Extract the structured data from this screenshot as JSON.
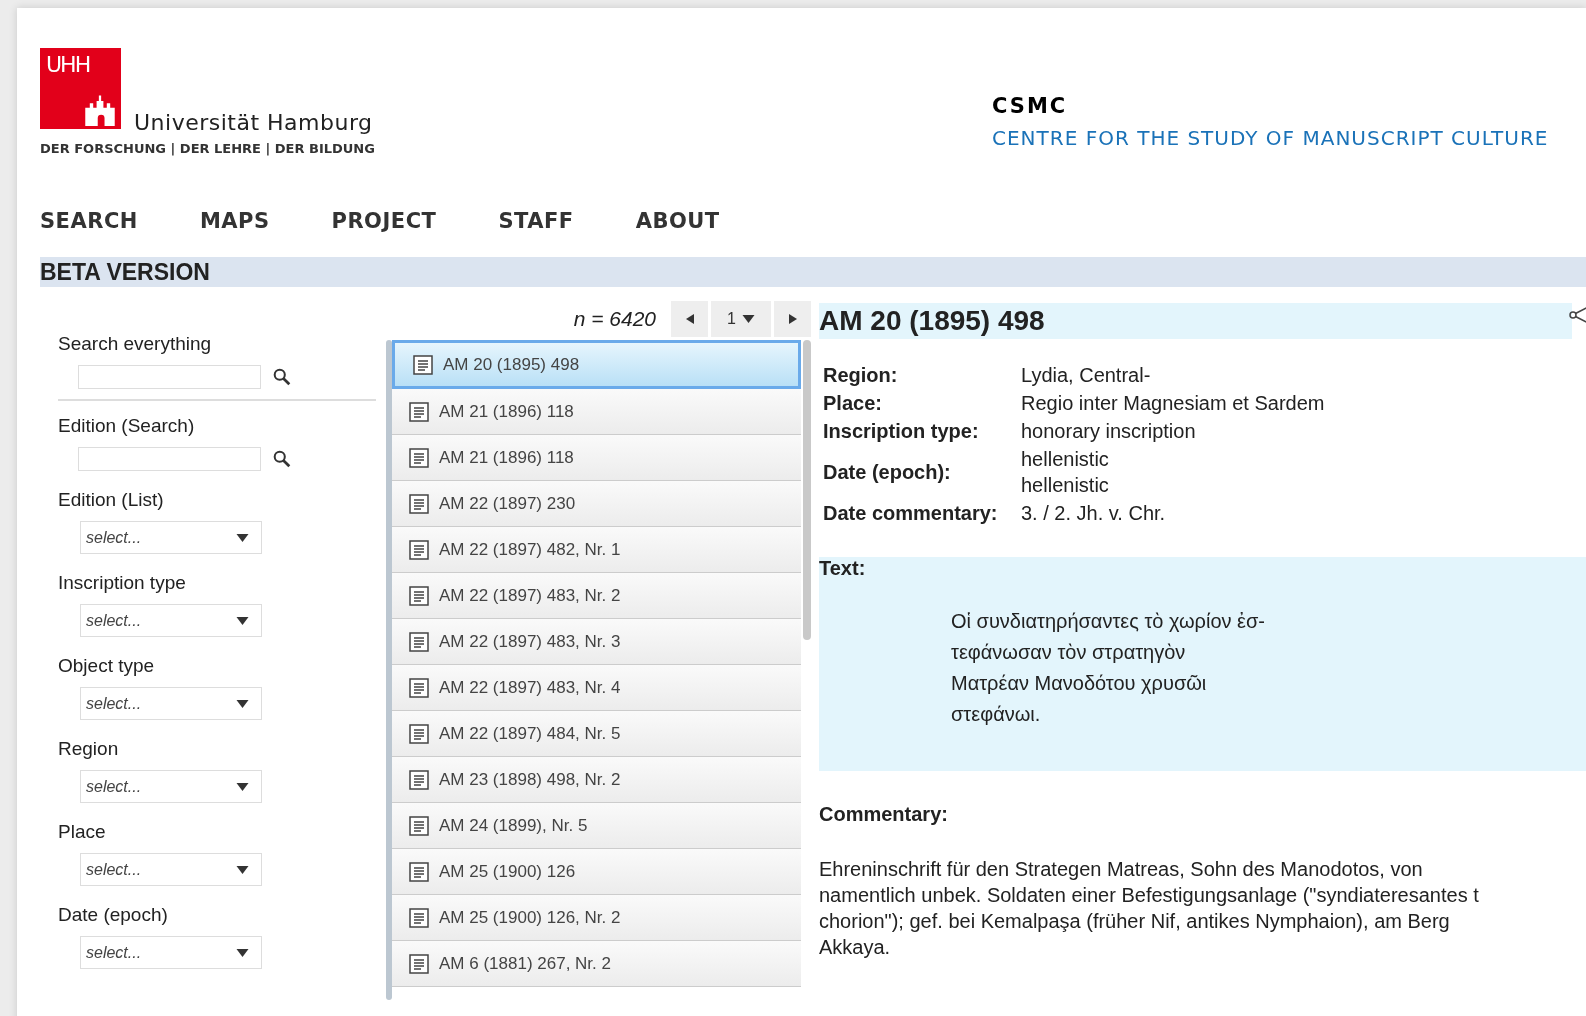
{
  "header": {
    "logo_mark": "UHH",
    "university": "Universität Hamburg",
    "motto": "DER FORSCHUNG | DER LEHRE | DER BILDUNG",
    "short": "CSMC",
    "centre": "CENTRE FOR THE STUDY OF MANUSCRIPT CULTURE"
  },
  "nav": [
    {
      "label": "SEARCH"
    },
    {
      "label": "MAPS"
    },
    {
      "label": "PROJECT"
    },
    {
      "label": "STAFF"
    },
    {
      "label": "ABOUT"
    }
  ],
  "banner": "BETA VERSION",
  "filters": [
    {
      "label": "Search everything",
      "kind": "text"
    },
    {
      "label": "Edition (Search)",
      "kind": "text"
    },
    {
      "label": "Edition (List)",
      "kind": "select",
      "placeholder": "select..."
    },
    {
      "label": "Inscription type",
      "kind": "select",
      "placeholder": "select..."
    },
    {
      "label": "Object type",
      "kind": "select",
      "placeholder": "select..."
    },
    {
      "label": "Region",
      "kind": "select",
      "placeholder": "select..."
    },
    {
      "label": "Place",
      "kind": "select",
      "placeholder": "select..."
    },
    {
      "label": "Date (epoch)",
      "kind": "select",
      "placeholder": "select..."
    }
  ],
  "pager": {
    "count": "n = 6420",
    "page": "1"
  },
  "results": [
    {
      "label": "AM 20 (1895) 498",
      "selected": true
    },
    {
      "label": "AM 21 (1896) 118",
      "selected": false
    },
    {
      "label": "AM 21 (1896) 118",
      "selected": false
    },
    {
      "label": "AM 22 (1897) 230",
      "selected": false
    },
    {
      "label": "AM 22 (1897) 482, Nr. 1",
      "selected": false
    },
    {
      "label": "AM 22 (1897) 483, Nr. 2",
      "selected": false
    },
    {
      "label": "AM 22 (1897) 483, Nr. 3",
      "selected": false
    },
    {
      "label": "AM 22 (1897) 483, Nr. 4",
      "selected": false
    },
    {
      "label": "AM 22 (1897) 484, Nr. 5",
      "selected": false
    },
    {
      "label": "AM 23 (1898) 498, Nr. 2",
      "selected": false
    },
    {
      "label": "AM 24 (1899), Nr. 5",
      "selected": false
    },
    {
      "label": "AM 25 (1900) 126",
      "selected": false
    },
    {
      "label": "AM 25 (1900) 126, Nr. 2",
      "selected": false
    },
    {
      "label": "AM 6 (1881) 267, Nr. 2",
      "selected": false
    }
  ],
  "detail": {
    "title": "AM 20 (1895) 498",
    "fields": [
      {
        "label": "Region:",
        "values": [
          "Lydia, Central-"
        ]
      },
      {
        "label": "Place:",
        "values": [
          "Regio inter Magnesiam et Sardem"
        ]
      },
      {
        "label": "Inscription type:",
        "values": [
          "honorary inscription"
        ]
      },
      {
        "label": "Date (epoch):",
        "values": [
          "hellenistic",
          "hellenistic"
        ]
      },
      {
        "label": "Date commentary:",
        "values": [
          "3. / 2. Jh. v. Chr."
        ]
      }
    ],
    "text_heading": "Text:",
    "text_lines": [
      "Οἱ συνδιατηρήσαντες τὸ χωρίον ἐσ-",
      "τεφάνωσαν τὸν στρατηγὸν",
      "Ματρέαν Μανοδότου χρυσῶι",
      "στεφάνωι."
    ],
    "commentary_heading": "Commentary:",
    "commentary_lines": [
      "Ehreninschrift für den Strategen Matreas, Sohn des Manodotos, von",
      "namentlich unbek. Soldaten einer Befestigungsanlage (\"syndiateresantes t",
      "chorion\"); gef. bei Kemalpaşa (früher Nif, antikes Nymphaion), am Berg",
      "Akkaya."
    ]
  }
}
